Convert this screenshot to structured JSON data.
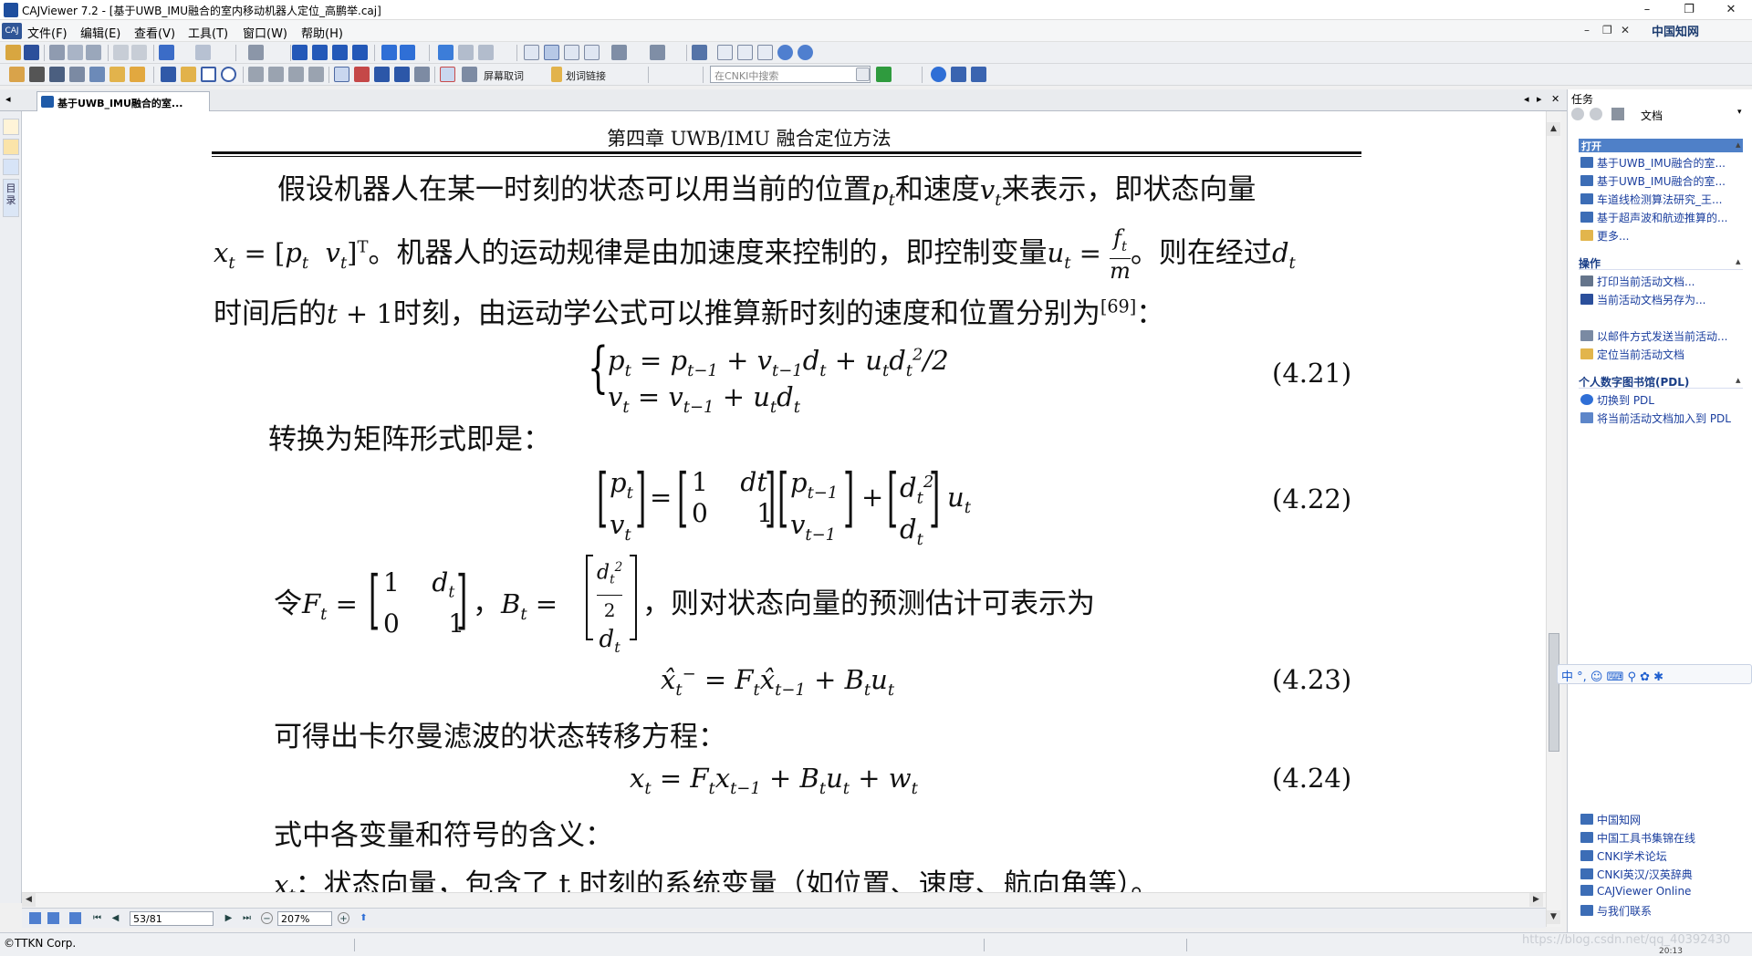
{
  "window": {
    "title": "CAJViewer 7.2 - [基于UWB_IMU融合的室内移动机器人定位_高鹏举.caj]",
    "controls": {
      "minimize": "–",
      "restore": "❐",
      "close": "✕"
    }
  },
  "menubar": {
    "items": [
      "文件(F)",
      "编辑(E)",
      "查看(V)",
      "工具(T)",
      "窗口(W)",
      "帮助(H)"
    ],
    "mdi_controls": {
      "minimize": "–",
      "restore": "❐",
      "close": "✕"
    },
    "brand": "中国知网"
  },
  "toolbar2": {
    "fullscreen_label": "屏幕取词",
    "wordlink_label": "划词链接",
    "search_placeholder": "在CNKI中搜索"
  },
  "tabs": [
    {
      "label": "基于UWB_IMU融合的室..."
    }
  ],
  "tabbar": {
    "left_arrow": "◂",
    "right_arrow": "▸",
    "close": "✕"
  },
  "left_strip": {
    "directory_label": "目录"
  },
  "document": {
    "header": "第四章 UWB/IMU 融合定位方法",
    "para1_line1_a": "假设机器人在某一时刻的状态可以用当前的位置",
    "para1_line1_b": "和速度",
    "para1_line1_c": "来表示，即状态向量",
    "para1_line2_a": "。机器人的运动规律是由加速度来控制的，即控制变量",
    "para1_line2_b": "。则在经过",
    "para1_line3_a": "时间后的",
    "para1_line3_b": "时刻，由运动学公式可以推算新时刻的速度和位置分别为",
    "citation": "[69]",
    "para1_line3_end": "：",
    "eq421_no": "(4.21)",
    "para2": "转换为矩阵形式即是：",
    "eq422_no": "(4.22)",
    "para3_a": "令",
    "para3_comma": "，",
    "para3_b": "，则对状态向量的预测估计可表示为",
    "eq423_no": "(4.23)",
    "para4": "可得出卡尔曼滤波的状态转移方程：",
    "eq424_no": "(4.24)",
    "para5": "式中各变量和符号的含义：",
    "para6_b": "：状态向量，包含了 t 时刻的系统变量（如位置、速度、航向角等）。"
  },
  "statusnav": {
    "page_value": "53/81",
    "zoom_value": "207%"
  },
  "statusbar": {
    "copyright": "©TTKN Corp.",
    "watermark": "https://blog.csdn.net/qq_40392430",
    "time": "20:13"
  },
  "task_panel": {
    "header": "任务",
    "doc_label": "文档",
    "sections": [
      {
        "title": "打开",
        "links": [
          "基于UWB_IMU融合的室...",
          "基于UWB_IMU融合的室...",
          "车道线检测算法研究_王...",
          "基于超声波和航迹推算的...",
          "更多..."
        ]
      },
      {
        "title": "操作",
        "links": [
          "打印当前活动文档...",
          "当前活动文档另存为...",
          "以邮件方式发送当前活动...",
          "定位当前活动文档"
        ]
      },
      {
        "title": "个人数字图书馆(PDL)",
        "links": [
          "切换到 PDL",
          "将当前活动文档加入到 PDL"
        ]
      }
    ],
    "bottom_links": [
      "中国知网",
      "中国工具书集锦在线",
      "CNKI学术论坛",
      "CNKI英汉/汉英辞典",
      "CAJViewer Online",
      "与我们联系"
    ]
  },
  "ime_bar": "中 °, ☺ ⌨ ⚲ ✿ ✱",
  "colors": {
    "link": "#1a3e9e",
    "section_title": "#1a3e87",
    "active_section": "#4f80c8"
  }
}
